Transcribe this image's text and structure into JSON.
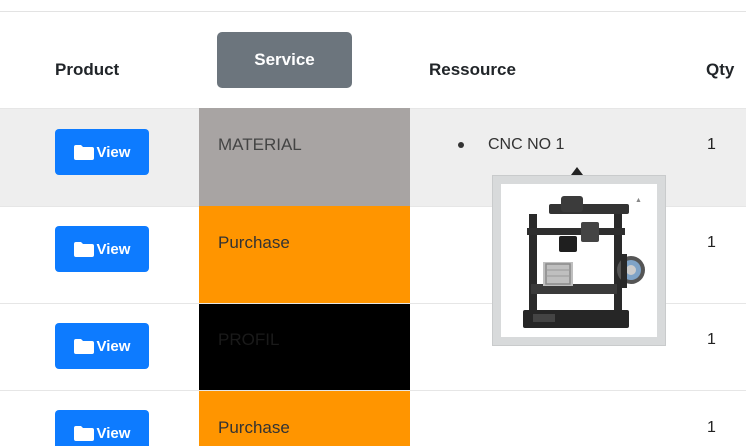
{
  "header": {
    "product": "Product",
    "service": "Service",
    "ressource": "Ressource",
    "qty": "Qty"
  },
  "rows": [
    {
      "view_label": "View",
      "service": "MATERIAL",
      "service_color": "#a8a4a3",
      "service_text_color": "#444444",
      "ressource": "CNC NO 1",
      "qty": "1"
    },
    {
      "view_label": "View",
      "service": "Purchase",
      "service_color": "#ff9500",
      "service_text_color": "#333333",
      "ressource": "",
      "qty": "1"
    },
    {
      "view_label": "View",
      "service": "PROFIL",
      "service_color": "#000000",
      "service_text_color": "#1a1a1a",
      "ressource": "",
      "qty": "1"
    },
    {
      "view_label": "View",
      "service": "Purchase",
      "service_color": "#ff9500",
      "service_text_color": "#333333",
      "ressource": "",
      "qty": "1"
    }
  ],
  "popover": {
    "image_icon": "3d-printer-image",
    "caption_mark": "▲"
  },
  "colors": {
    "view_button": "#0d7bff",
    "service_header_button": "#6c757d",
    "first_row_background": "#eeeeee"
  }
}
